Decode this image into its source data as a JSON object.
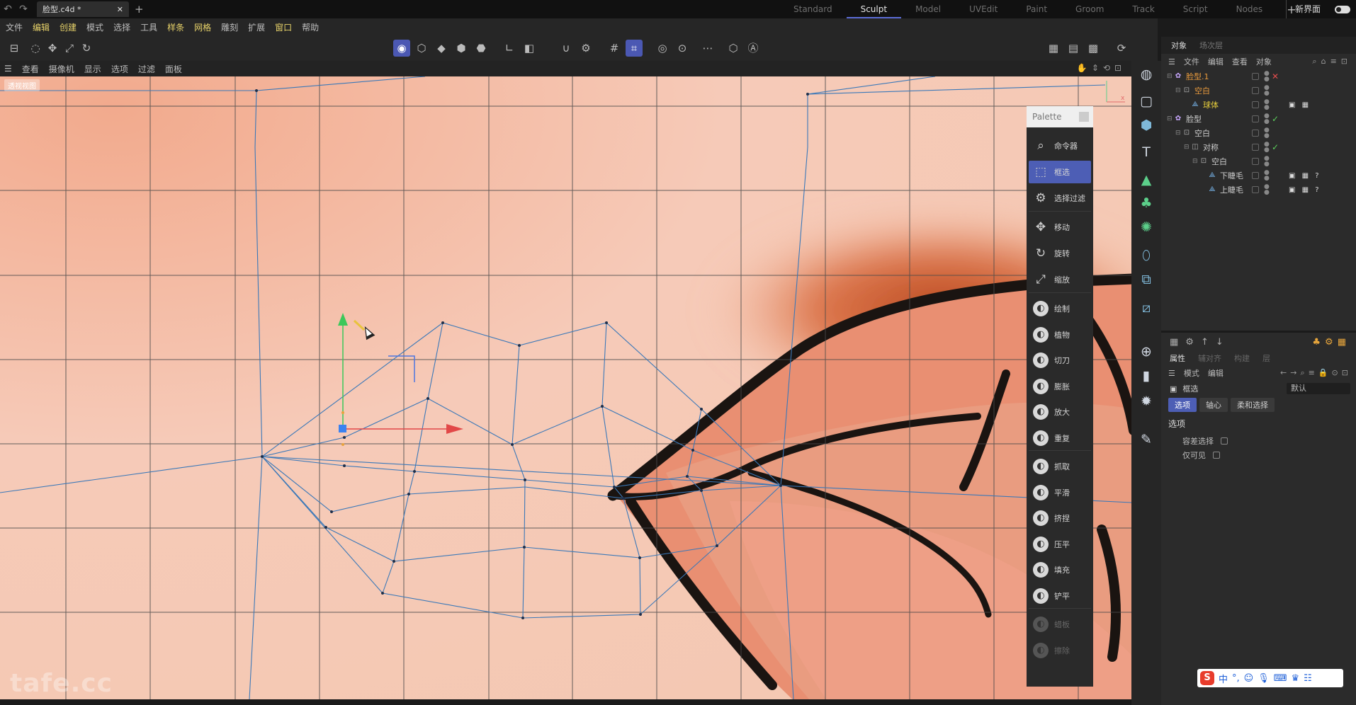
{
  "topbar": {
    "doc_tab": "脸型.c4d *",
    "layouts": [
      "Standard",
      "Sculpt",
      "Model",
      "UVEdit",
      "Paint",
      "Groom",
      "Track",
      "Script",
      "Nodes"
    ],
    "active_layout": "Sculpt",
    "new_ui": "新界面"
  },
  "menubar": [
    "文件",
    "编辑",
    "创建",
    "模式",
    "选择",
    "工具",
    "样条",
    "网格",
    "雕刻",
    "扩展",
    "窗口",
    "帮助"
  ],
  "viewbar": [
    "查看",
    "摄像机",
    "显示",
    "选项",
    "过滤",
    "面板"
  ],
  "viewport": {
    "camera_label": "透视视图",
    "watermark": "tafe.cc"
  },
  "palette": {
    "title": "Palette",
    "items": [
      {
        "label": "命令器",
        "icon": "search-icon",
        "sel": false
      },
      {
        "label": "框选",
        "icon": "box-select-icon",
        "sel": true
      },
      {
        "label": "选择过滤",
        "icon": "filter-icon",
        "sel": false
      },
      {
        "label": "移动",
        "icon": "move-icon",
        "sel": false
      },
      {
        "label": "旋转",
        "icon": "rotate-icon",
        "sel": false
      },
      {
        "label": "缩放",
        "icon": "scale-icon",
        "sel": false
      },
      {
        "label": "绘制",
        "icon": "brush-draw-icon",
        "sel": false
      },
      {
        "label": "植物",
        "icon": "brush-grow-icon",
        "sel": false
      },
      {
        "label": "切刀",
        "icon": "brush-knife-icon",
        "sel": false
      },
      {
        "label": "膨胀",
        "icon": "brush-inflate-icon",
        "sel": false
      },
      {
        "label": "放大",
        "icon": "brush-magnify-icon",
        "sel": false
      },
      {
        "label": "重复",
        "icon": "brush-repeat-icon",
        "sel": false
      },
      {
        "label": "抓取",
        "icon": "brush-grab-icon",
        "sel": false
      },
      {
        "label": "平滑",
        "icon": "brush-smooth-icon",
        "sel": false
      },
      {
        "label": "挤捏",
        "icon": "brush-pinch-icon",
        "sel": false
      },
      {
        "label": "压平",
        "icon": "brush-flatten-icon",
        "sel": false
      },
      {
        "label": "填充",
        "icon": "brush-fill-icon",
        "sel": false
      },
      {
        "label": "铲平",
        "icon": "brush-scrape-icon",
        "sel": false
      },
      {
        "label": "蜡板",
        "icon": "brush-wax-icon",
        "sel": false
      },
      {
        "label": "擦除",
        "icon": "brush-erase-icon",
        "sel": false
      }
    ]
  },
  "object_manager": {
    "tabs": [
      "对象",
      "场次层"
    ],
    "menu": [
      "文件",
      "编辑",
      "查看",
      "对象"
    ],
    "rows": [
      {
        "name": "脸型.1",
        "depth": 0,
        "icon": "cloner-icon",
        "color": "or",
        "mark": "✕",
        "markc": "red",
        "tags": ""
      },
      {
        "name": "空白",
        "depth": 1,
        "icon": "null-icon",
        "color": "or",
        "mark": "",
        "markc": "",
        "tags": ""
      },
      {
        "name": "球体",
        "depth": 2,
        "icon": "sphere-icon",
        "color": "ye",
        "mark": "",
        "markc": "",
        "tags": "▣ ▦"
      },
      {
        "name": "脸型",
        "depth": 0,
        "icon": "cloner-icon",
        "color": "",
        "mark": "✓",
        "markc": "grn",
        "tags": ""
      },
      {
        "name": "空白",
        "depth": 1,
        "icon": "null-icon",
        "color": "",
        "mark": "",
        "markc": "",
        "tags": ""
      },
      {
        "name": "对称",
        "depth": 2,
        "icon": "symmetry-icon",
        "color": "",
        "mark": "✓",
        "markc": "grn",
        "tags": ""
      },
      {
        "name": "空白",
        "depth": 3,
        "icon": "null-icon",
        "color": "",
        "mark": "",
        "markc": "",
        "tags": ""
      },
      {
        "name": "下睫毛",
        "depth": 4,
        "icon": "polygon-icon",
        "color": "",
        "mark": "",
        "markc": "",
        "tags": "▣ ▦ ?"
      },
      {
        "name": "上睫毛",
        "depth": 4,
        "icon": "polygon-icon",
        "color": "",
        "mark": "",
        "markc": "",
        "tags": "▣ ▦ ?"
      }
    ]
  },
  "attribute_manager": {
    "tabs": [
      "属性",
      "辅对齐",
      "构建",
      "层"
    ],
    "menu": [
      "模式",
      "编辑"
    ],
    "object": "框选",
    "preset": "默认",
    "subtabs": [
      "选项",
      "轴心",
      "柔和选择"
    ],
    "section": "选项",
    "options": [
      "容差选择",
      "仅可见"
    ]
  },
  "ime": {
    "logo": "S",
    "lang": "中"
  }
}
